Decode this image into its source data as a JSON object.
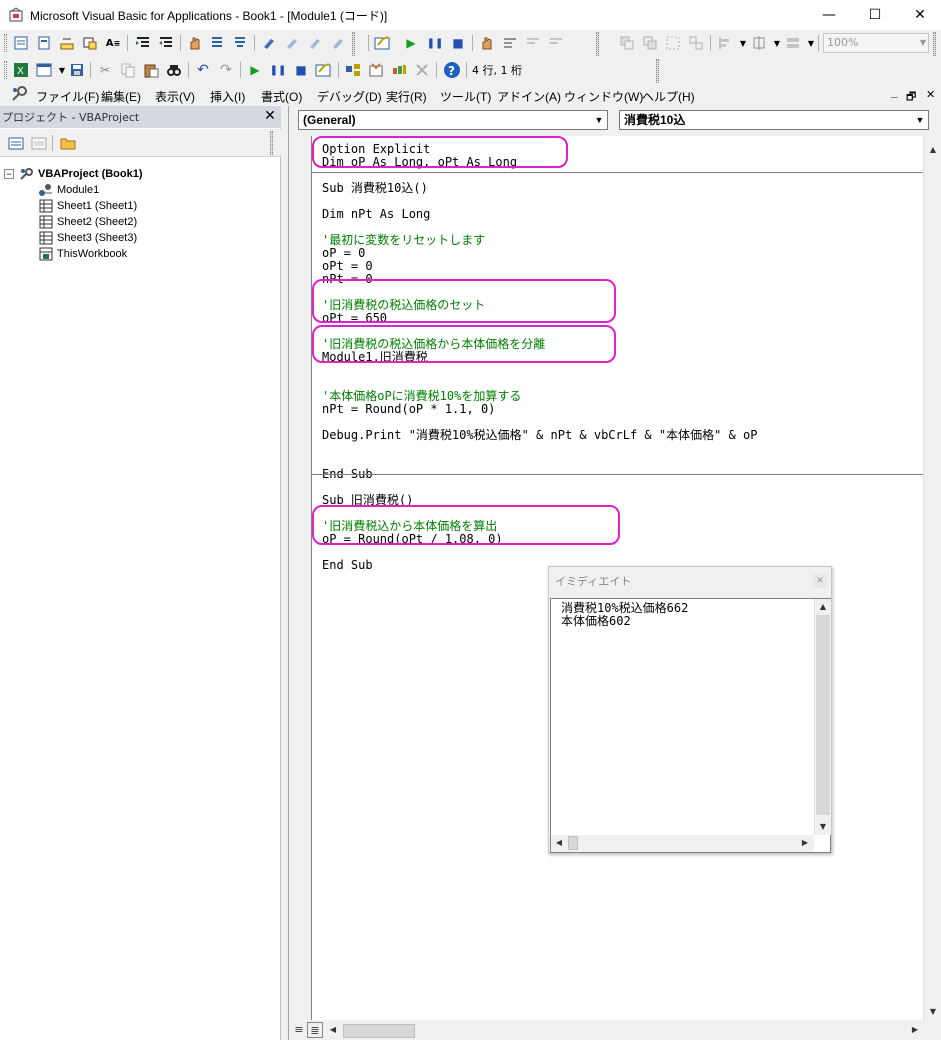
{
  "window": {
    "title": "Microsoft Visual Basic for Applications - Book1 - [Module1 (コード)]",
    "minimize": "—",
    "maximize": "☐",
    "close": "✕"
  },
  "toolbar_standard": {
    "cursor_position": "4 行, 1 桁",
    "zoom": "100%"
  },
  "menu": {
    "items": [
      "ファイル(F)",
      "編集(E)",
      "表示(V)",
      "挿入(I)",
      "書式(O)",
      "デバッグ(D)",
      "実行(R)",
      "ツール(T)",
      "アドイン(A)",
      "ウィンドウ(W)",
      "ヘルプ(H)"
    ],
    "mdi_minimize": "_",
    "mdi_restore": "🗗",
    "mdi_close": "✕"
  },
  "project": {
    "header": "プロジェクト - VBAProject",
    "close": "✕",
    "tree": [
      {
        "label": "VBAProject (Book1)",
        "icon": "vbaproject-icon"
      },
      {
        "label": "Module1",
        "icon": "module-icon"
      },
      {
        "label": "Sheet1 (Sheet1)",
        "icon": "sheet-icon"
      },
      {
        "label": "Sheet2 (Sheet2)",
        "icon": "sheet-icon"
      },
      {
        "label": "Sheet3 (Sheet3)",
        "icon": "sheet-icon"
      },
      {
        "label": "ThisWorkbook",
        "icon": "workbook-icon"
      }
    ]
  },
  "code": {
    "object_combo": "(General)",
    "procedure_combo": "消費税10込",
    "lines": [
      {
        "text": "Option Explicit",
        "type": "code"
      },
      {
        "text": "Dim oP As Long, oPt As Long",
        "type": "code"
      },
      {
        "text": "Sub 消費税10込()",
        "type": "code"
      },
      {
        "text": "Dim nPt As Long",
        "type": "code"
      },
      {
        "text": "'最初に変数をリセットします",
        "type": "comment"
      },
      {
        "text": "oP = 0",
        "type": "code"
      },
      {
        "text": "oPt = 0",
        "type": "code"
      },
      {
        "text": "nPt = 0",
        "type": "code"
      },
      {
        "text": "'旧消費税の税込価格のセット",
        "type": "comment"
      },
      {
        "text": "oPt = 650",
        "type": "code"
      },
      {
        "text": "'旧消費税の税込価格から本体価格を分離",
        "type": "comment"
      },
      {
        "text": "Module1.旧消費税",
        "type": "code"
      },
      {
        "text": "'本体価格oPに消費税10%を加算する",
        "type": "comment"
      },
      {
        "text": "nPt = Round(oP * 1.1, 0)",
        "type": "code"
      },
      {
        "text": "Debug.Print \"消費税10%税込価格\" & nPt & vbCrLf & \"本体価格\" & oP",
        "type": "code"
      },
      {
        "text": "End Sub",
        "type": "code"
      },
      {
        "text": "Sub 旧消費税()",
        "type": "code"
      },
      {
        "text": "'旧消費税込から本体価格を算出",
        "type": "comment"
      },
      {
        "text": "oP = Round(oPt / 1.08, 0)",
        "type": "code"
      },
      {
        "text": "End Sub",
        "type": "code"
      }
    ]
  },
  "immediate": {
    "title": "イミディエイト",
    "close": "✕",
    "lines": [
      "消費税10%税込価格662",
      "本体価格602"
    ]
  },
  "colors": {
    "highlight": "#e020c8",
    "comment": "#008000"
  }
}
